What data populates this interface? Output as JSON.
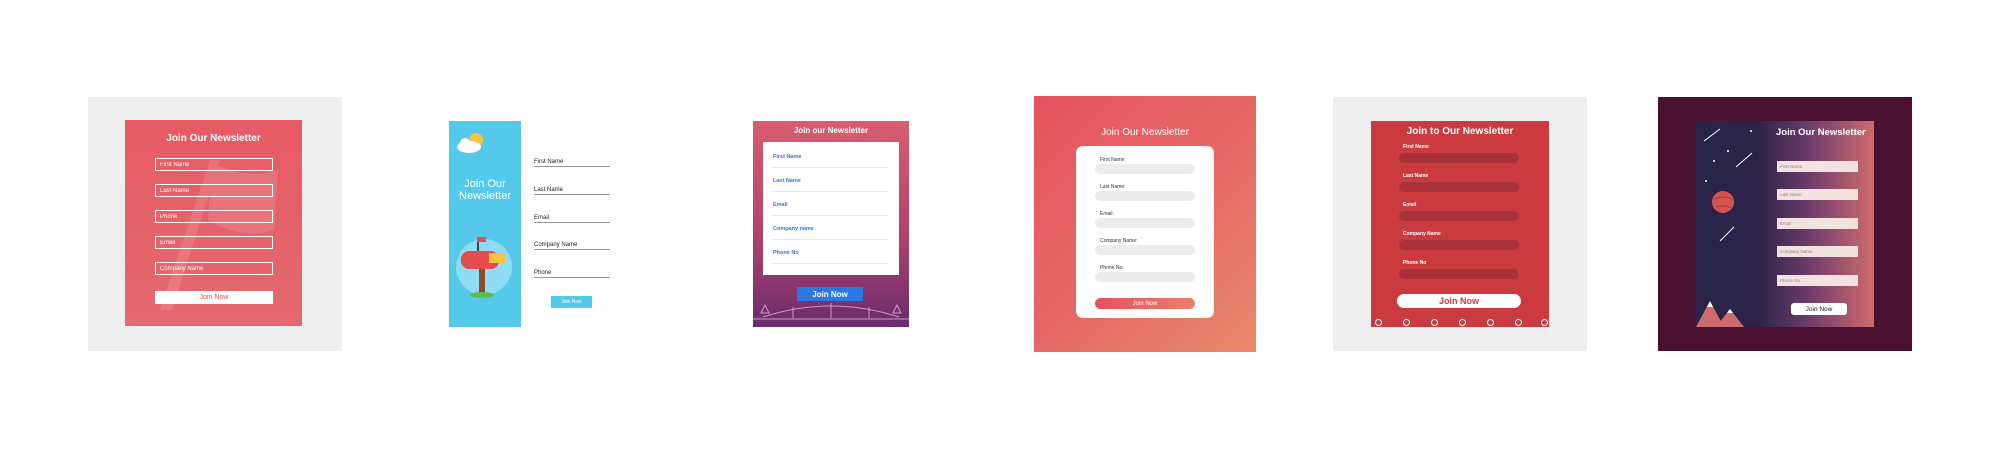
{
  "cards": [
    {
      "title": "Join Our Newsletter",
      "fields": [
        "First Name",
        "Last Name",
        "Phone",
        "Email",
        "Company Name"
      ],
      "button": "Join Now",
      "accent": "#e65a63"
    },
    {
      "title": "Join Our Newsletter",
      "fields": [
        "First Name",
        "Last Name",
        "Email",
        "Company Name",
        "Phone"
      ],
      "button": "Join Now",
      "accent": "#55c9ea"
    },
    {
      "title": "Join our Newsletter",
      "fields": [
        "First Name",
        "Last Name",
        "Email",
        "Company name",
        "Phone No"
      ],
      "button": "Join Now",
      "accent": "#2b78e0"
    },
    {
      "title": "Join Our Newsletter",
      "fields": [
        "First Name:",
        "Last Name:",
        "Email:",
        "Company Name:",
        "Phone No:"
      ],
      "button": "Join Now",
      "accent": "#e6525f"
    },
    {
      "title": "Join to Our Newsletter",
      "fields": [
        "First Name",
        "Last Name",
        "Email",
        "Company Name",
        "Phone No"
      ],
      "button": "Join Now",
      "accent": "#cb3a3e"
    },
    {
      "title": "Join Our Newsletter",
      "fields": [
        "First Name",
        "Last Name",
        "Email",
        "Company Name",
        "Phone No"
      ],
      "button": "Join Now",
      "accent": "#4b1130"
    }
  ]
}
